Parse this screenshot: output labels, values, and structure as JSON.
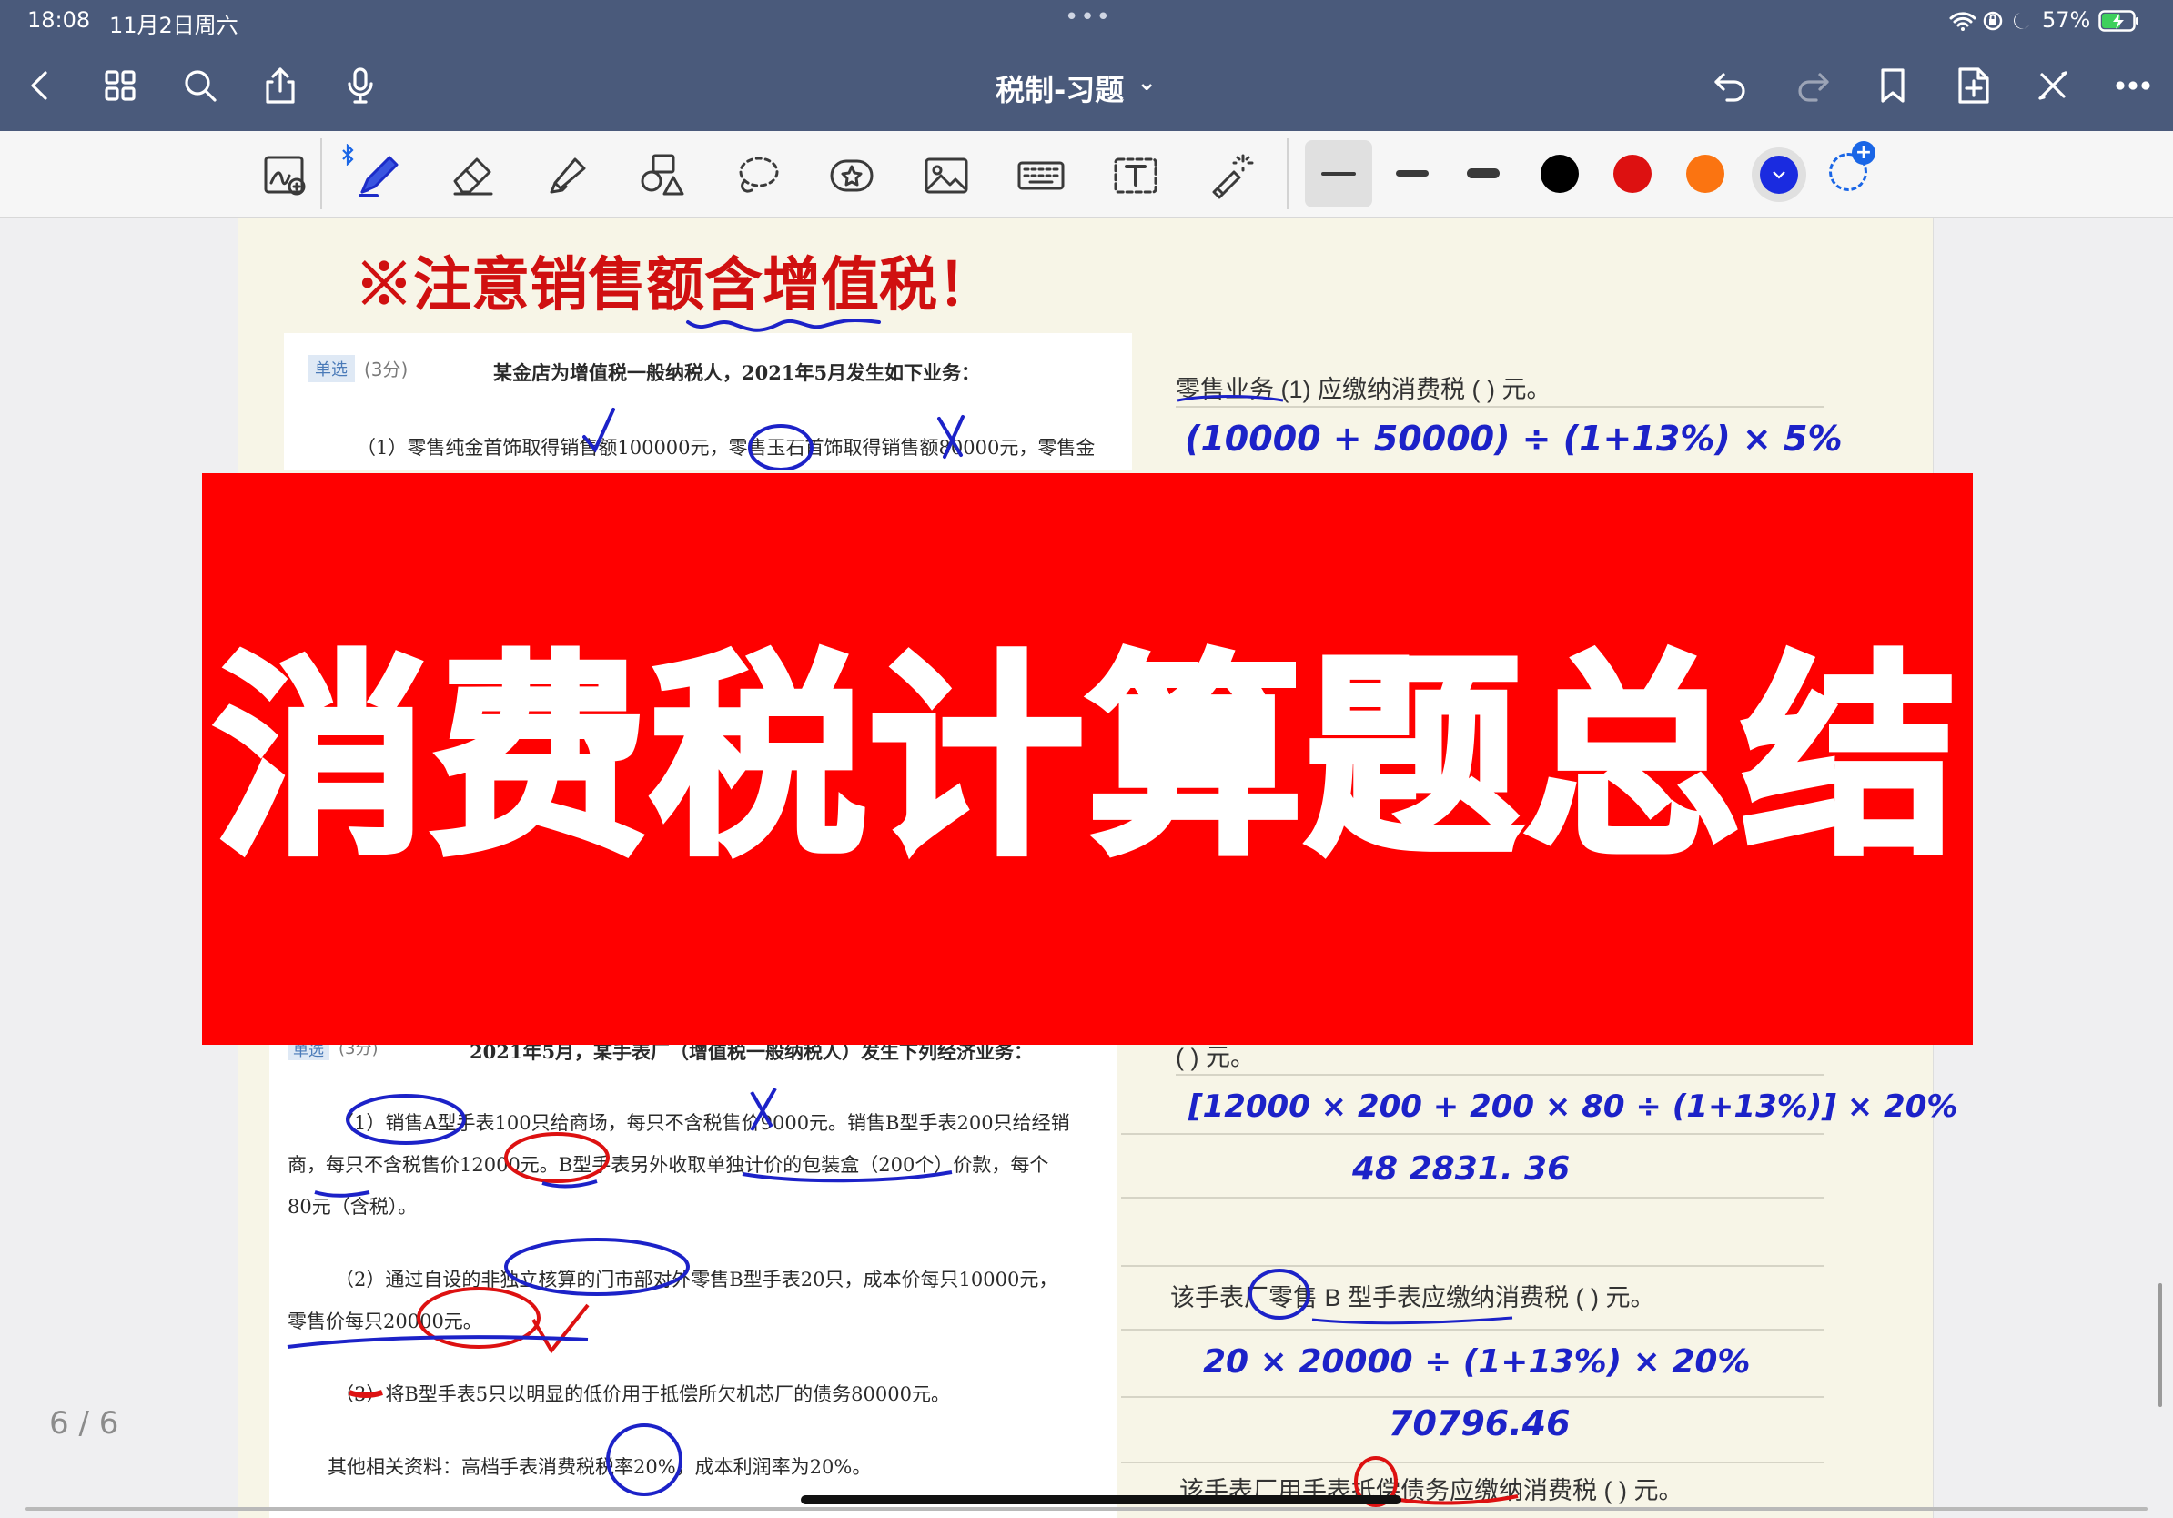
{
  "status": {
    "time": "18:08",
    "date": "11月2日周六",
    "battery": "57%",
    "dots": "•••"
  },
  "nav": {
    "title": "税制-习题",
    "title_chevron": "⌄"
  },
  "toolbar": {
    "active_color": "#1a2be0",
    "colors": [
      "#000000",
      "#dd1111",
      "#fb7411",
      "#1a2be0"
    ]
  },
  "page_indicator": "6 / 6",
  "banner": {
    "text": "消费税计算题总结"
  },
  "note": {
    "heading": "※注意销售额含增值税！",
    "q1_tag": "单选",
    "q1_score": "(3分)",
    "q1_intro": "某金店为增值税一般纳税人，2021年5月发生如下业务：",
    "q1_line1": "（1）零售纯金首饰取得销售额100000元，零售玉石首饰取得销售额80000元，零售金",
    "q2_tag": "单选",
    "q2_score": "(3分)",
    "q2_intro": "2021年5月，某手表厂（增值税一般纳税人）发生下列经济业务：",
    "q2_p1a": "（1）销售A型手表100只给商场，每只不含税售价9000元。销售B型手表200只给经销",
    "q2_p1b": "商，每只不含税售价12000元。B型手表另外收取单独计价的包装盒（200个）价款，每个",
    "q2_p1c": "80元（含税）。",
    "q2_p2a": "（2）通过自设的非独立核算的门市部对外零售B型手表20只，成本价每只10000元，",
    "q2_p2b": "零售价每只20000元。",
    "q2_p3": "（3）将B型手表5只以明显的低价用于抵偿所欠机芯厂的债务80000元。",
    "q2_other": "其他相关资料：高档手表消费税税率20%，成本利润率为20%。",
    "r1_q": "零售业务 (1) 应缴纳消费税 (    ) 元。",
    "r1_hw": "(10000 + 50000) ÷ (1+13%) × 5%",
    "r2_q": "(    ) 元。",
    "r2_hw": "[12000 × 200 + 200 × 80 ÷ (1+13%)] × 20%",
    "r2_ans": "48 2831. 36",
    "r3_q": "该手表厂零售 B 型手表应缴纳消费税 (    ) 元。",
    "r3_hw": "20 × 20000 ÷ (1+13%) × 20%",
    "r3_ans": "70796.46",
    "r4_q": "该手表厂用手表抵偿债务应缴纳消费税 (    ) 元。"
  }
}
